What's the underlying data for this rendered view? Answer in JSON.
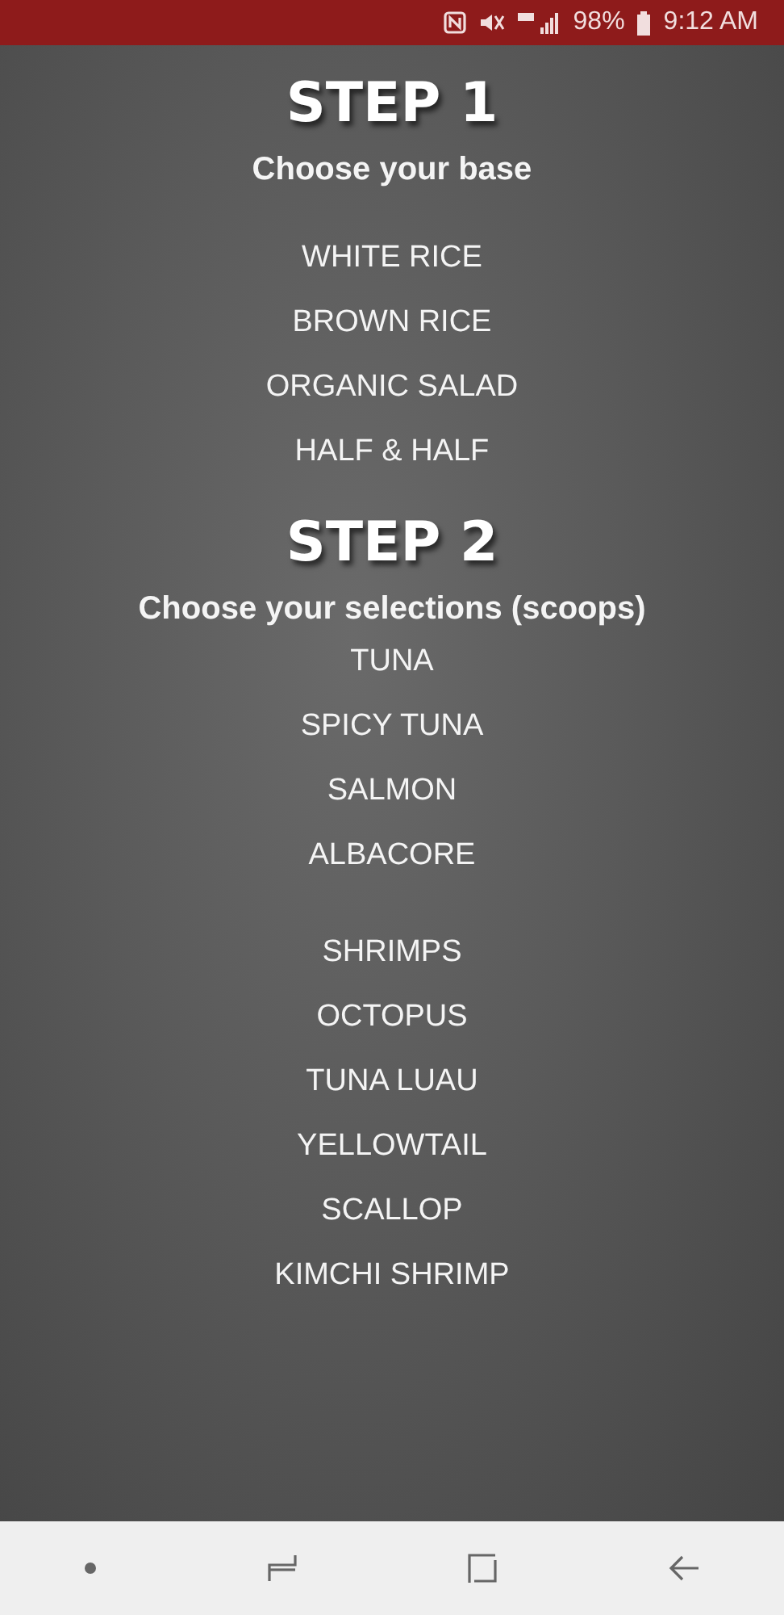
{
  "status_bar": {
    "battery": "98%",
    "time": "9:12 AM"
  },
  "steps": [
    {
      "title": "STEP 1",
      "subtitle": "Choose your base",
      "groups": [
        [
          "WHITE RICE",
          "BROWN RICE",
          "ORGANIC SALAD",
          "HALF & HALF"
        ]
      ]
    },
    {
      "title": "STEP 2",
      "subtitle": "Choose your selections (scoops)",
      "groups": [
        [
          "TUNA",
          "SPICY TUNA",
          "SALMON",
          "ALBACORE"
        ],
        [
          "SHRIMPS",
          "OCTOPUS",
          "TUNA LUAU",
          "YELLOWTAIL",
          "SCALLOP",
          "KIMCHI SHRIMP"
        ]
      ]
    }
  ]
}
